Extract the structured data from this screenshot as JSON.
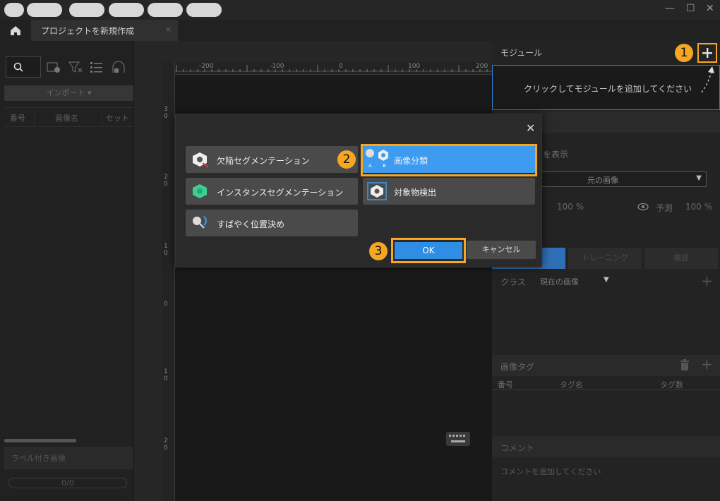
{
  "window": {
    "minimize": "—",
    "maximize": "☐",
    "close": "✕"
  },
  "tab": {
    "label": "プロジェクトを新規作成",
    "close": "×"
  },
  "left_panel": {
    "import_label": "インポート ▾",
    "columns": [
      "番号",
      "画像名",
      "セット"
    ],
    "labeled_images": "ラベル付き画像",
    "progress": "0/0"
  },
  "ruler": {
    "h_labels": [
      "-200",
      "-100",
      "0",
      "100",
      "200"
    ],
    "v_labels": [
      "3\n0",
      "2\n0",
      "1\n0",
      "0",
      "1\n0",
      "2\n0"
    ]
  },
  "right_panel": {
    "module_title": "モジュール",
    "module_hint": "クリックしてモジュールを追加してください",
    "show_label": "を表示",
    "source_value": "元の画像",
    "pct1": "100 %",
    "predict_label": "予測",
    "pct2": "100 %",
    "tabs": [
      "",
      "トレーニング",
      "検証"
    ],
    "class_label": "クラス",
    "class_value": "現在の画像",
    "tag_title": "画像タグ",
    "tag_columns": [
      "番号",
      "タグ名",
      "タグ数"
    ],
    "comment_title": "コメント",
    "comment_hint": "コメントを追加してください"
  },
  "dialog": {
    "close": "✕",
    "options": [
      {
        "label": "欠陥セグメンテーション",
        "icon": "defect-segmentation-icon"
      },
      {
        "label": "画像分類",
        "icon": "image-classification-icon",
        "selected": true
      },
      {
        "label": "インスタンスセグメンテーション",
        "icon": "instance-segmentation-icon"
      },
      {
        "label": "対象物検出",
        "icon": "object-detection-icon"
      },
      {
        "label": "すばやく位置決め",
        "icon": "fast-positioning-icon"
      }
    ],
    "ok": "OK",
    "cancel": "キャンセル"
  },
  "badges": [
    "1",
    "2",
    "3"
  ],
  "colors": {
    "accent": "#2f8de4",
    "highlight": "#f5a623",
    "selected": "#3d9bf0"
  }
}
